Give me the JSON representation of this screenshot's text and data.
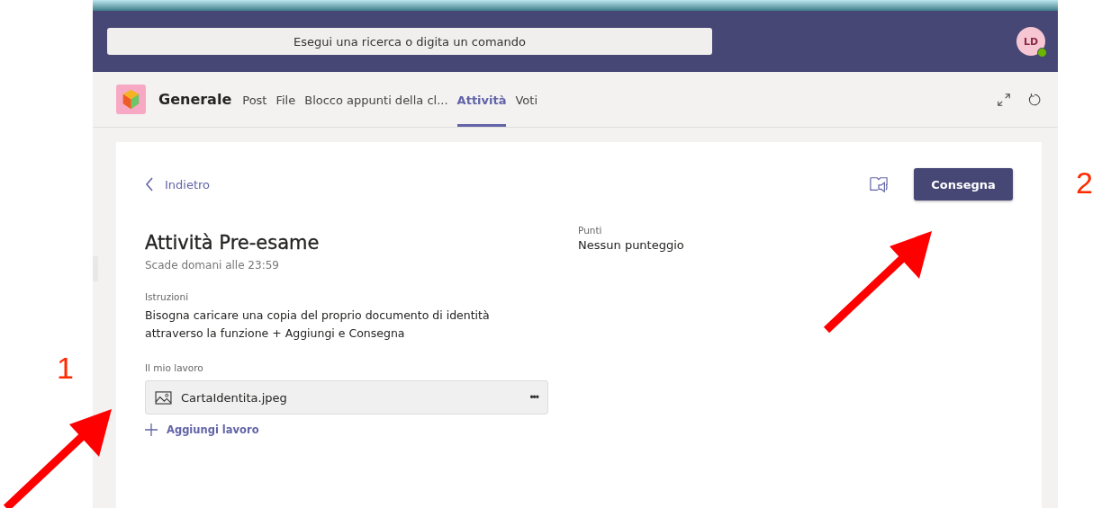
{
  "search": {
    "placeholder": "Esegui una ricerca o digita un comando"
  },
  "avatar": {
    "initials": "LD",
    "color": "#6bb700"
  },
  "channel": {
    "name": "Generale"
  },
  "tabs": [
    {
      "label": "Post",
      "selected": false
    },
    {
      "label": "File",
      "selected": false
    },
    {
      "label": "Blocco appunti della cl...",
      "selected": false
    },
    {
      "label": "Attività",
      "selected": true
    },
    {
      "label": "Voti",
      "selected": false
    }
  ],
  "back": {
    "label": "Indietro"
  },
  "submit_button": {
    "label": "Consegna"
  },
  "assignment": {
    "title": "Attività Pre-esame",
    "due": "Scade domani alle 23:59",
    "instructions_label": "Istruzioni",
    "instructions": "Bisogna caricare una copia del proprio documento di identità attraverso la funzione + Aggiungi e Consegna",
    "work_label": "Il mio lavoro",
    "files": [
      {
        "name": "CartaIdentita.jpeg",
        "menu": "•••"
      }
    ],
    "add_work": "Aggiungi lavoro"
  },
  "points": {
    "label": "Punti",
    "value": "Nessun punteggio"
  },
  "annotations": [
    {
      "number": "1"
    },
    {
      "number": "2"
    }
  ]
}
